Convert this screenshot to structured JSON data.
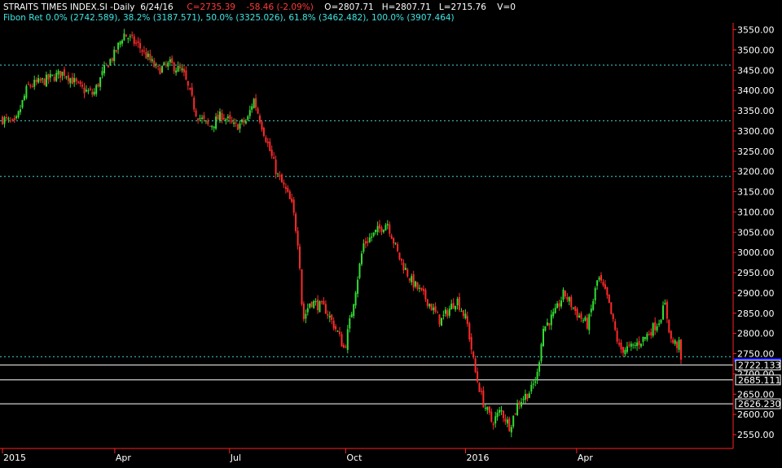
{
  "header": {
    "symbol": "STRAITS TIMES INDEX.SI -Daily",
    "date": "6/24/16",
    "close": "C=2735.39",
    "change": "-58.46 (-2.09%)",
    "open": "O=2807.71",
    "high": "H=2807.71",
    "low": "L=2715.76",
    "volume": "V=0",
    "fib_label": "Fibon Ret 0.0% (2742.589), 38.2% (3187.571), 50.0% (3325.026), 61.8% (3462.482), 100.0% (3907.464)"
  },
  "colors": {
    "background": "#000000",
    "up": "#33dd33",
    "down": "#ff2a2a",
    "fib_line": "#44d6d6",
    "level_line": "#ffffff",
    "axis": "#ff2020",
    "last_price_marker": "#1010ee"
  },
  "chart_data": {
    "type": "candlestick",
    "title": "STRAITS TIMES INDEX.SI -Daily",
    "y_ticks": [
      2550,
      2600,
      2650,
      2700,
      2750,
      2800,
      2850,
      2900,
      2950,
      3000,
      3050,
      3100,
      3150,
      3200,
      3250,
      3300,
      3350,
      3400,
      3450,
      3500,
      3550
    ],
    "y_tick_labels": [
      "2550.00",
      "2600.00",
      "2650.00",
      "2700.00",
      "2750.00",
      "2800.00",
      "2850.00",
      "2900.00",
      "2950.00",
      "3000.00",
      "3050.00",
      "3100.00",
      "3150.00",
      "3200.00",
      "3250.00",
      "3300.00",
      "3350.00",
      "3400.00",
      "3450.00",
      "3500.00",
      "3550.00"
    ],
    "ylim": [
      2520,
      3570
    ],
    "x_labels": [
      {
        "label": "2015",
        "date": "2015-01-02"
      },
      {
        "label": "Apr",
        "date": "2015-04-01"
      },
      {
        "label": "Jul",
        "date": "2015-07-01"
      },
      {
        "label": "Oct",
        "date": "2015-10-01"
      },
      {
        "label": "2016",
        "date": "2016-01-04"
      },
      {
        "label": "Apr",
        "date": "2016-04-01"
      }
    ],
    "xlim": [
      "2015-01-02",
      "2016-06-24"
    ],
    "fibonacci_levels": [
      {
        "pct": "0.0%",
        "value": 2742.589
      },
      {
        "pct": "38.2%",
        "value": 3187.571
      },
      {
        "pct": "50.0%",
        "value": 3325.026
      },
      {
        "pct": "61.8%",
        "value": 3462.482
      },
      {
        "pct": "100.0%",
        "value": 3907.464
      }
    ],
    "horizontal_levels": [
      {
        "value": 2722.133,
        "label": "2722.133"
      },
      {
        "value": 2685.111,
        "label": "2685.111"
      },
      {
        "value": 2626.23,
        "label": "2626.230"
      }
    ],
    "last_price": 2735.39,
    "close_path": [
      {
        "date": "2015-01-02",
        "close": 3330
      },
      {
        "date": "2015-01-12",
        "close": 3315
      },
      {
        "date": "2015-01-22",
        "close": 3410
      },
      {
        "date": "2015-02-05",
        "close": 3425
      },
      {
        "date": "2015-02-20",
        "close": 3445
      },
      {
        "date": "2015-03-05",
        "close": 3405
      },
      {
        "date": "2015-03-15",
        "close": 3390
      },
      {
        "date": "2015-03-25",
        "close": 3460
      },
      {
        "date": "2015-04-01",
        "close": 3490
      },
      {
        "date": "2015-04-08",
        "close": 3540
      },
      {
        "date": "2015-04-20",
        "close": 3510
      },
      {
        "date": "2015-05-05",
        "close": 3450
      },
      {
        "date": "2015-05-15",
        "close": 3465
      },
      {
        "date": "2015-05-25",
        "close": 3445
      },
      {
        "date": "2015-06-05",
        "close": 3340
      },
      {
        "date": "2015-06-15",
        "close": 3310
      },
      {
        "date": "2015-06-25",
        "close": 3340
      },
      {
        "date": "2015-07-05",
        "close": 3310
      },
      {
        "date": "2015-07-15",
        "close": 3325
      },
      {
        "date": "2015-07-20",
        "close": 3380
      },
      {
        "date": "2015-07-25",
        "close": 3330
      },
      {
        "date": "2015-08-01",
        "close": 3260
      },
      {
        "date": "2015-08-08",
        "close": 3190
      },
      {
        "date": "2015-08-15",
        "close": 3150
      },
      {
        "date": "2015-08-20",
        "close": 3110
      },
      {
        "date": "2015-08-25",
        "close": 3010
      },
      {
        "date": "2015-08-28",
        "close": 2830
      },
      {
        "date": "2015-09-03",
        "close": 2880
      },
      {
        "date": "2015-09-15",
        "close": 2860
      },
      {
        "date": "2015-09-25",
        "close": 2800
      },
      {
        "date": "2015-09-30",
        "close": 2760
      },
      {
        "date": "2015-10-05",
        "close": 2840
      },
      {
        "date": "2015-10-15",
        "close": 3020
      },
      {
        "date": "2015-10-25",
        "close": 3050
      },
      {
        "date": "2015-11-03",
        "close": 3075
      },
      {
        "date": "2015-11-12",
        "close": 2990
      },
      {
        "date": "2015-11-22",
        "close": 2930
      },
      {
        "date": "2015-12-05",
        "close": 2880
      },
      {
        "date": "2015-12-15",
        "close": 2830
      },
      {
        "date": "2015-12-28",
        "close": 2885
      },
      {
        "date": "2016-01-05",
        "close": 2830
      },
      {
        "date": "2016-01-12",
        "close": 2700
      },
      {
        "date": "2016-01-18",
        "close": 2630
      },
      {
        "date": "2016-01-25",
        "close": 2580
      },
      {
        "date": "2016-02-01",
        "close": 2610
      },
      {
        "date": "2016-02-08",
        "close": 2570
      },
      {
        "date": "2016-02-15",
        "close": 2630
      },
      {
        "date": "2016-02-25",
        "close": 2660
      },
      {
        "date": "2016-03-01",
        "close": 2700
      },
      {
        "date": "2016-03-05",
        "close": 2810
      },
      {
        "date": "2016-03-15",
        "close": 2850
      },
      {
        "date": "2016-03-22",
        "close": 2900
      },
      {
        "date": "2016-04-01",
        "close": 2850
      },
      {
        "date": "2016-04-10",
        "close": 2820
      },
      {
        "date": "2016-04-18",
        "close": 2940
      },
      {
        "date": "2016-04-25",
        "close": 2890
      },
      {
        "date": "2016-05-05",
        "close": 2760
      },
      {
        "date": "2016-05-15",
        "close": 2765
      },
      {
        "date": "2016-05-25",
        "close": 2790
      },
      {
        "date": "2016-06-05",
        "close": 2830
      },
      {
        "date": "2016-06-10",
        "close": 2870
      },
      {
        "date": "2016-06-15",
        "close": 2780
      },
      {
        "date": "2016-06-21",
        "close": 2770
      },
      {
        "date": "2016-06-23",
        "close": 2794
      },
      {
        "date": "2016-06-24",
        "close": 2735.39
      }
    ]
  }
}
